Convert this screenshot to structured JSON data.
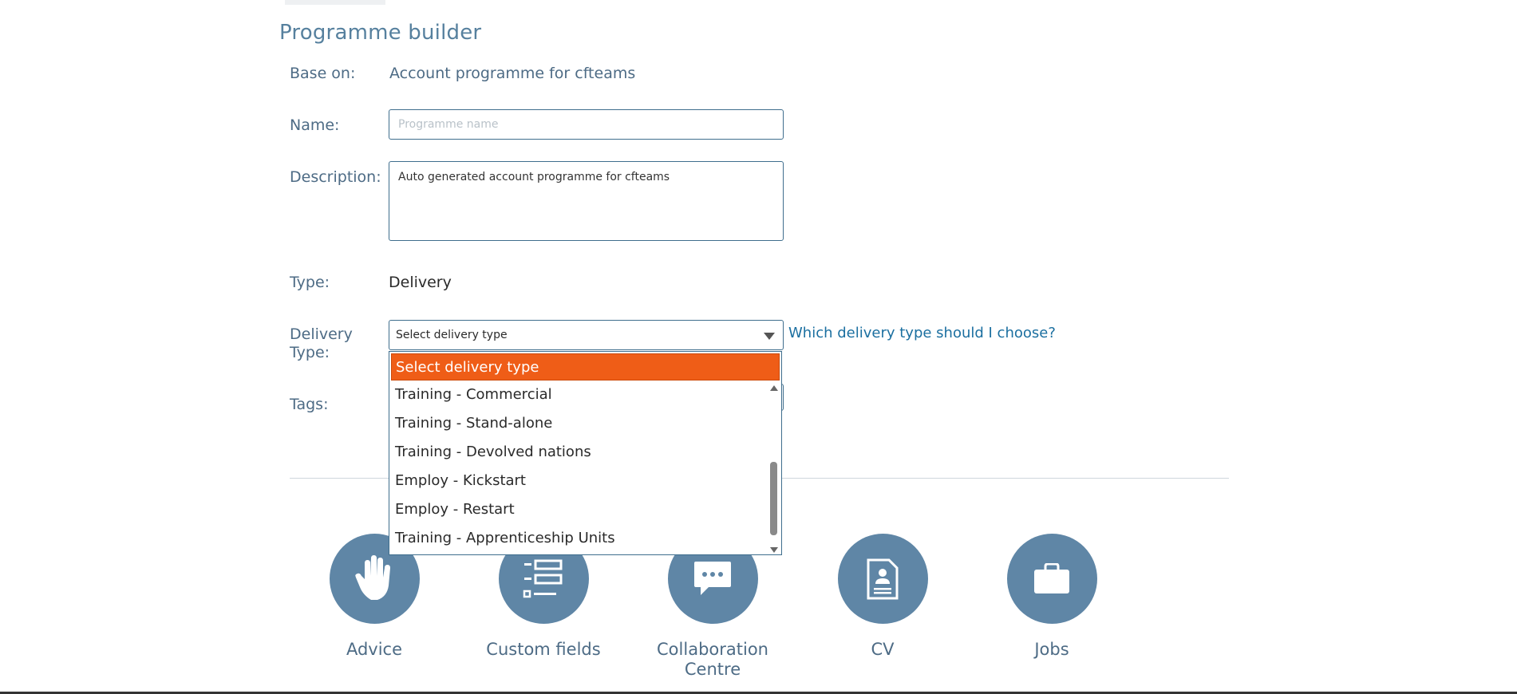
{
  "page_title": "Programme builder",
  "form": {
    "base_on_label": "Base on:",
    "base_on_value": "Account programme for cfteams",
    "name_label": "Name:",
    "name_value": "",
    "name_placeholder": "Programme name",
    "description_label": "Description:",
    "description_value": "Auto generated account programme for cfteams",
    "type_label": "Type:",
    "type_value": "Delivery",
    "delivery_type_label_line1": "Delivery",
    "delivery_type_label_line2": "Type:",
    "delivery_type_selected": "Select delivery type",
    "delivery_help_link": "Which delivery type should I choose?",
    "tags_label": "Tags:"
  },
  "dropdown": {
    "options": [
      "Select delivery type",
      "Training - Commercial",
      "Training - Stand-alone",
      "Training - Devolved nations",
      "Employ - Kickstart",
      "Employ - Restart",
      "Training - Apprenticeship Units"
    ],
    "highlighted_index": 0,
    "highlight_color": "#ef5d17"
  },
  "features": [
    {
      "label": "Advice",
      "icon": "hand-icon"
    },
    {
      "label": "Custom fields",
      "icon": "list-fields-icon"
    },
    {
      "label": "Collaboration Centre",
      "icon": "chat-bubble-icon"
    },
    {
      "label": "CV",
      "icon": "document-icon"
    },
    {
      "label": "Jobs",
      "icon": "briefcase-icon"
    }
  ],
  "colors": {
    "accent": "#5f86a6",
    "label": "#4d6b85",
    "link": "#1b6fa0",
    "input_border": "#3f6e8d"
  }
}
